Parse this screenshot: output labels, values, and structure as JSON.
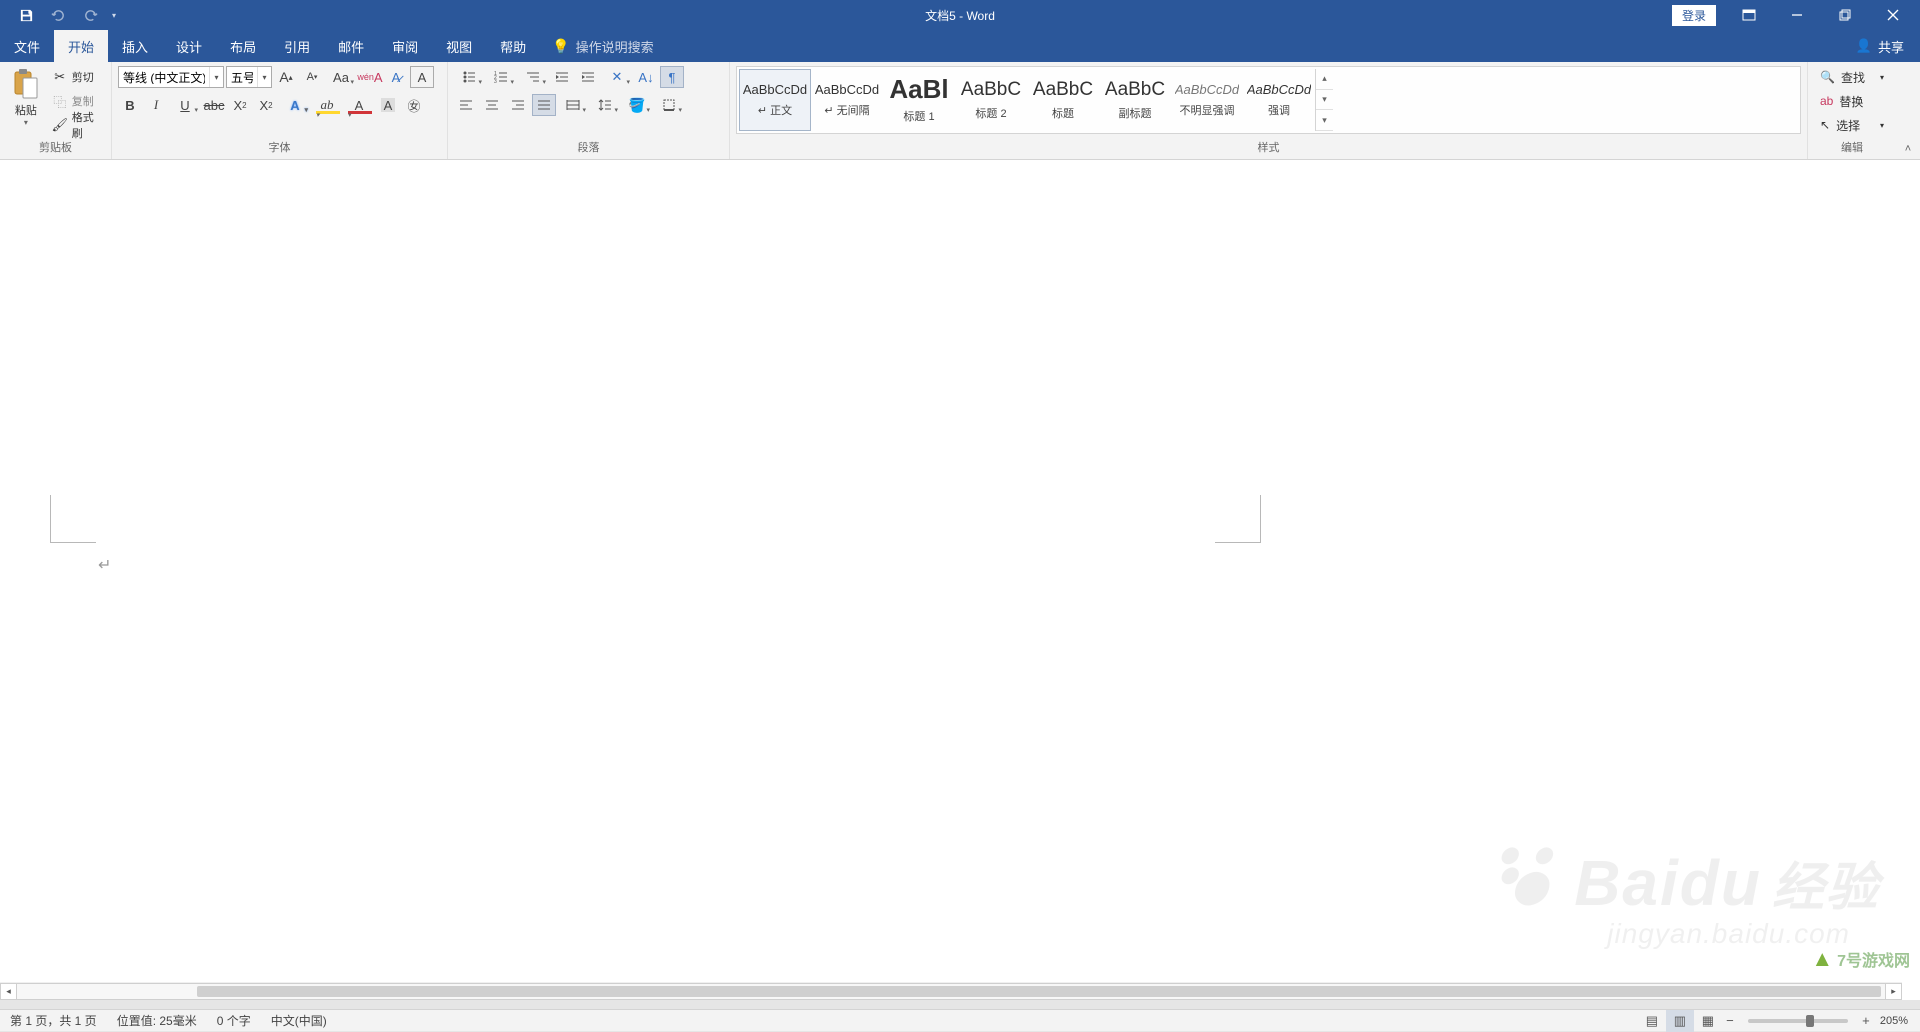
{
  "title": "文档5 - Word",
  "qat": {
    "save": "save",
    "undo": "undo",
    "redo": "redo"
  },
  "login": "登录",
  "share": "共享",
  "tabs": {
    "file": "文件",
    "home": "开始",
    "insert": "插入",
    "design": "设计",
    "layout": "布局",
    "references": "引用",
    "mailings": "邮件",
    "review": "审阅",
    "view": "视图",
    "help": "帮助"
  },
  "tellme": "操作说明搜索",
  "clipboard": {
    "label": "剪贴板",
    "paste": "粘贴",
    "cut": "剪切",
    "copy": "复制",
    "painter": "格式刷"
  },
  "font": {
    "label": "字体",
    "name": "等线 (中文正文)",
    "size": "五号"
  },
  "paragraph": {
    "label": "段落"
  },
  "styles": {
    "label": "样式",
    "items": [
      {
        "preview": "AaBbCcDd",
        "name": "↵ 正文",
        "css": "font-size:13px;"
      },
      {
        "preview": "AaBbCcDd",
        "name": "↵ 无间隔",
        "css": "font-size:13px;"
      },
      {
        "preview": "AaBl",
        "name": "标题 1",
        "css": "font-size:26px;font-weight:bold;"
      },
      {
        "preview": "AaBbC",
        "name": "标题 2",
        "css": "font-size:19px;"
      },
      {
        "preview": "AaBbC",
        "name": "标题",
        "css": "font-size:19px;"
      },
      {
        "preview": "AaBbC",
        "name": "副标题",
        "css": "font-size:19px;"
      },
      {
        "preview": "AaBbCcDd",
        "name": "不明显强调",
        "css": "font-size:13px;font-style:italic;color:#777;"
      },
      {
        "preview": "AaBbCcDd",
        "name": "强调",
        "css": "font-size:13px;font-style:italic;"
      }
    ]
  },
  "editing": {
    "label": "编辑",
    "find": "查找",
    "replace": "替换",
    "select": "选择"
  },
  "status": {
    "page": "第 1 页，共 1 页",
    "position": "位置值: 25毫米",
    "words": "0 个字",
    "lang": "中文(中国)",
    "zoom": "205%"
  },
  "watermark": {
    "brand": "Baidu",
    "sub": "经验",
    "url": "jingyan.baidu.com",
    "corner": "7号游戏网"
  }
}
